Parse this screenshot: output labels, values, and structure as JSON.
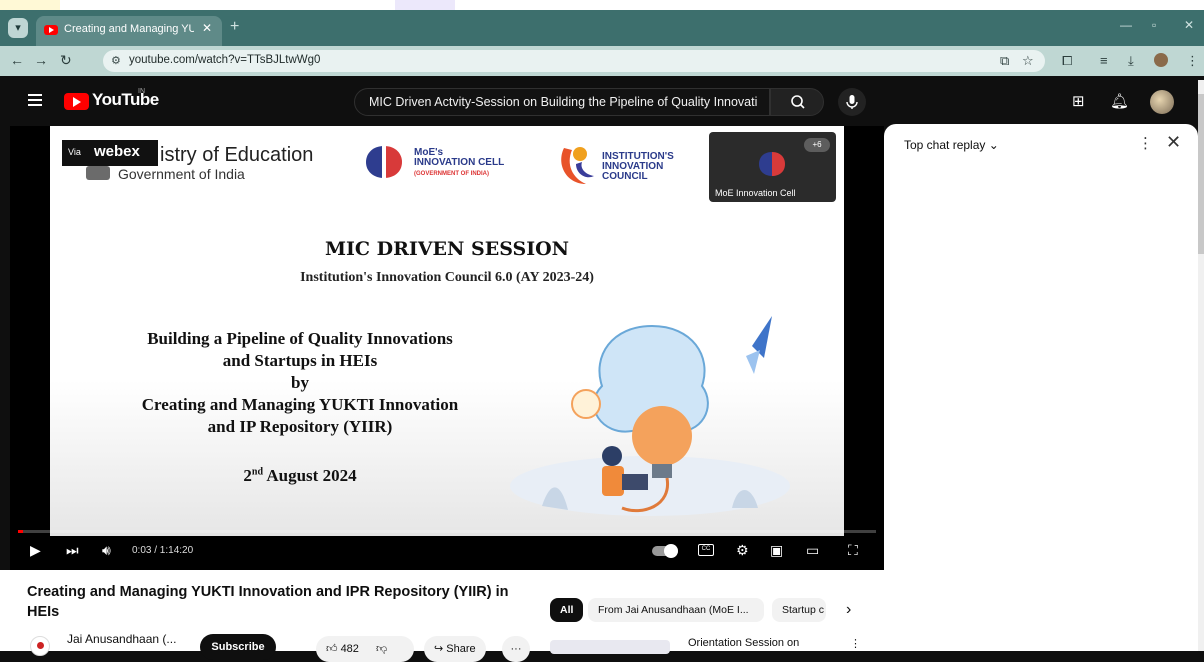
{
  "browser": {
    "tab_title": "Creating and Managing YUKTI I",
    "tab_close": "✕",
    "new_tab": "+",
    "url": "youtube.com/watch?v=TTsBJLtwWg0"
  },
  "youtube": {
    "logo_text": "YouTube",
    "region": "IN",
    "search_query": "MIC Driven Actvity-Session on Building the Pipeline of Quality Innovati"
  },
  "slide": {
    "webex_via": "Via",
    "webex_brand": "webex",
    "ministry": "istry of Education",
    "government": "Government of India",
    "moe_cell_line1": "MoE's",
    "moe_cell_line2": "INNOVATION CELL",
    "moe_cell_line3": "(GOVERNMENT OF INDIA)",
    "iic_line1": "INSTITUTION'S",
    "iic_line2": "INNOVATION",
    "iic_line3": "COUNCIL",
    "cam_badge": "+6",
    "cam_label": "MoE Innovation Cell",
    "title": "MIC DRIVEN SESSION",
    "subtitle": "Institution's Innovation Council 6.0 (AY 2023-24)",
    "body_line1": "Building a Pipeline of Quality Innovations",
    "body_line2": "and Startups in HEIs",
    "body_line3": "by",
    "body_line4": "Creating and Managing YUKTI Innovation",
    "body_line5": "and IP Repository (YIIR)",
    "date_day": "2",
    "date_sup": "nd",
    "date_rest": " August 2024"
  },
  "player": {
    "time": "0:03 / 1:14:20",
    "progress_fraction": 0.0007,
    "cc_label": "CC"
  },
  "chat": {
    "header": "Top chat replay"
  },
  "video": {
    "title": "Creating and Managing YUKTI Innovation and IPR Repository (YIIR) in HEIs",
    "channel": "Jai Anusandhaan (...",
    "subscribe": "Subscribe",
    "likes": "482",
    "share": "Share",
    "more": "···"
  },
  "related": {
    "chips": [
      "All",
      "From Jai Anusandhaan (MoE I...",
      "Startup c"
    ],
    "next_arrow": "›",
    "first_title": "Orientation Session on"
  },
  "colors": {
    "tabbar": "#3d6f6d",
    "addressbar": "#bfd7d3",
    "youtube_red": "#ff0000"
  }
}
